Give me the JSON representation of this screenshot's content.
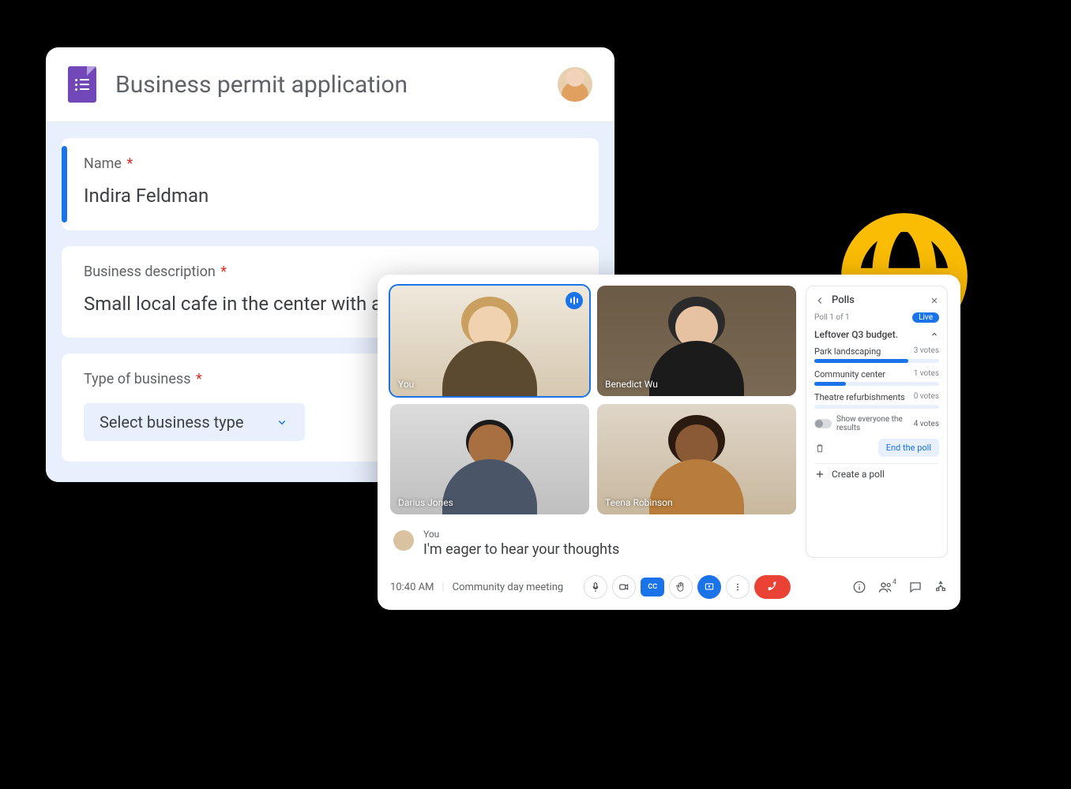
{
  "form": {
    "title": "Business permit application",
    "questions": {
      "name": {
        "label": "Name",
        "required": "*",
        "value": "Indira Feldman"
      },
      "desc": {
        "label": "Business description",
        "required": "*",
        "value": "Small local cafe in the center with an onsite bakery."
      },
      "type": {
        "label": "Type of business",
        "required": "*",
        "select_placeholder": "Select business type"
      }
    }
  },
  "meet": {
    "time": "10:40 AM",
    "meeting_name": "Community day meeting",
    "cc_label": "CC",
    "participants": {
      "self": "You",
      "p1": "Benedict Wu",
      "p2": "Darius Jones",
      "p3": "Teena Robinson"
    },
    "caption": {
      "author": "You",
      "text": "I'm eager to hear your thoughts"
    },
    "people_count": "4",
    "polls": {
      "title": "Polls",
      "sub": "Poll 1 of 1",
      "live": "Live",
      "question": "Leftover Q3 budget.",
      "options": {
        "o1": {
          "label": "Park landscaping",
          "votes": "3 votes",
          "pct": 75
        },
        "o2": {
          "label": "Community center",
          "votes": "1 votes",
          "pct": 25
        },
        "o3": {
          "label": "Theatre refurbishments",
          "votes": "0 votes",
          "pct": 0
        }
      },
      "show_results": "Show everyone the results",
      "total_votes": "4 votes",
      "end": "End the poll",
      "create": "Create a poll"
    }
  }
}
